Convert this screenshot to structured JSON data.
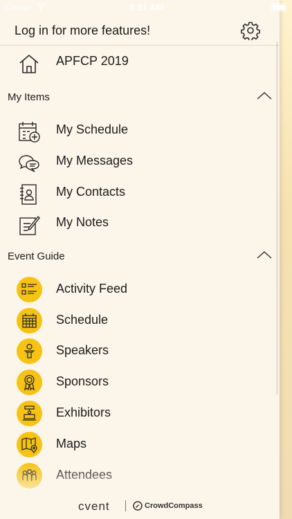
{
  "status_bar": {
    "carrier": "Carrier",
    "time": "8:51 AM"
  },
  "header": {
    "title": "Log in for more features!",
    "settings_icon": "gear-icon"
  },
  "top_item": {
    "label": "APFCP 2019",
    "icon": "home-icon"
  },
  "my_items": {
    "title": "My Items",
    "items": [
      {
        "label": "My Schedule",
        "icon": "calendar-add-icon"
      },
      {
        "label": "My Messages",
        "icon": "chat-bubbles-icon"
      },
      {
        "label": "My Contacts",
        "icon": "contact-book-icon"
      },
      {
        "label": "My Notes",
        "icon": "note-edit-icon"
      }
    ]
  },
  "event_guide": {
    "title": "Event Guide",
    "items": [
      {
        "label": "Activity Feed",
        "icon": "feed-list-icon"
      },
      {
        "label": "Schedule",
        "icon": "calendar-icon"
      },
      {
        "label": "Speakers",
        "icon": "speaker-podium-icon"
      },
      {
        "label": "Sponsors",
        "icon": "ribbon-award-icon"
      },
      {
        "label": "Exhibitors",
        "icon": "exhibitor-booth-icon"
      },
      {
        "label": "Maps",
        "icon": "map-pin-icon"
      },
      {
        "label": "Attendees",
        "icon": "people-group-icon"
      }
    ]
  },
  "footer": {
    "brand_left": "cvent",
    "brand_right": "CrowdCompass"
  },
  "colors": {
    "accent": "#f6c314",
    "background": "#fcf5e9"
  }
}
